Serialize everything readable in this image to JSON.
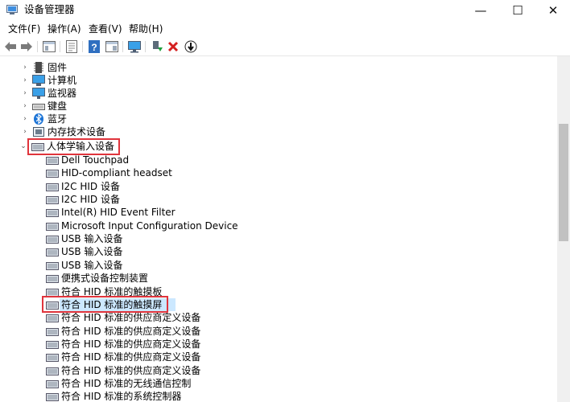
{
  "window": {
    "title": "设备管理器",
    "controls": {
      "minimize": "—",
      "maximize": "☐",
      "close": "✕"
    }
  },
  "menu": [
    {
      "label": "文件(F)"
    },
    {
      "label": "操作(A)"
    },
    {
      "label": "查看(V)"
    },
    {
      "label": "帮助(H)"
    }
  ],
  "toolbar": [
    {
      "icon": "back-icon"
    },
    {
      "icon": "forward-icon"
    },
    {
      "icon": "tree-view-icon"
    },
    {
      "icon": "properties-icon"
    },
    {
      "icon": "help-icon"
    },
    {
      "icon": "device-view-icon"
    },
    {
      "icon": "monitor-icon"
    },
    {
      "icon": "update-driver-icon"
    },
    {
      "icon": "uninstall-icon"
    },
    {
      "icon": "download-icon"
    }
  ],
  "tree": {
    "categories": [
      {
        "label": "固件",
        "icon": "firmware-icon"
      },
      {
        "label": "计算机",
        "icon": "computer-icon"
      },
      {
        "label": "监视器",
        "icon": "monitor-icon"
      },
      {
        "label": "键盘",
        "icon": "keyboard-icon"
      },
      {
        "label": "蓝牙",
        "icon": "bluetooth-icon"
      },
      {
        "label": "内存技术设备",
        "icon": "memory-icon"
      }
    ],
    "expanded": {
      "label": "人体学输入设备",
      "icon": "hid-icon",
      "children": [
        {
          "label": "Dell Touchpad"
        },
        {
          "label": "HID-compliant headset"
        },
        {
          "label": "I2C HID 设备"
        },
        {
          "label": "I2C HID 设备"
        },
        {
          "label": "Intel(R) HID Event Filter"
        },
        {
          "label": "Microsoft Input Configuration Device"
        },
        {
          "label": "USB 输入设备"
        },
        {
          "label": "USB 输入设备"
        },
        {
          "label": "USB 输入设备"
        },
        {
          "label": "便携式设备控制装置"
        },
        {
          "label": "符合 HID 标准的触摸板"
        },
        {
          "label": "符合 HID 标准的触摸屏",
          "selected": true
        },
        {
          "label": "符合 HID 标准的供应商定义设备"
        },
        {
          "label": "符合 HID 标准的供应商定义设备"
        },
        {
          "label": "符合 HID 标准的供应商定义设备"
        },
        {
          "label": "符合 HID 标准的供应商定义设备"
        },
        {
          "label": "符合 HID 标准的供应商定义设备"
        },
        {
          "label": "符合 HID 标准的无线通信控制"
        },
        {
          "label": "符合 HID 标准的系统控制器"
        }
      ]
    }
  },
  "colors": {
    "highlight_box": "#e0343c",
    "selection": "#cce8ff"
  }
}
